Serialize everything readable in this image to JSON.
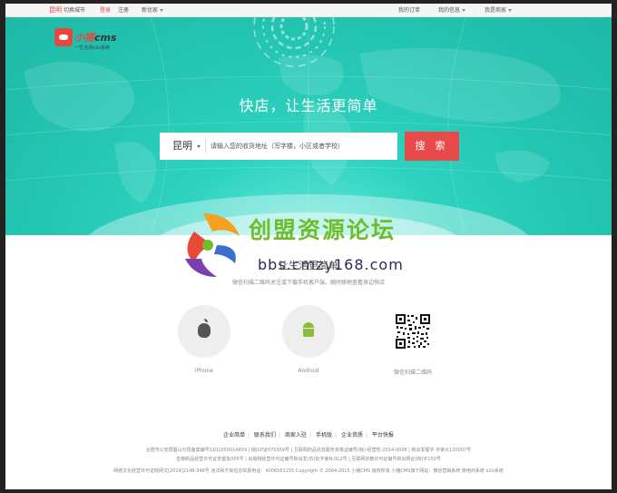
{
  "topbar": {
    "city": "昆明",
    "switch_city": "切换城市",
    "login": "登录",
    "register": "注册",
    "news": "新优家",
    "my_orders": "我的订单",
    "my_info": "我的信息",
    "merchant": "我是商家"
  },
  "logo": {
    "brand_cn": "小猪",
    "brand_en": "cms",
    "tagline": "一生活通o2o系统"
  },
  "hero": {
    "slogan": "快店，让生活更简单",
    "city_select": "昆明",
    "search_placeholder": "请输入您的收货地址（写字楼，小区或者学校）",
    "search_button": "搜 索"
  },
  "watermark": {
    "text": "创盟资源论坛",
    "url": "bbs.cmzy168.com"
  },
  "app": {
    "title": "让生活更简单",
    "subtitle": "微信扫描二维码关注或下载手机客户端，随时随地查看身边快店",
    "iphone": "iPhone",
    "android": "Android",
    "wechat": "微信扫描二维码"
  },
  "footer": {
    "links": [
      "企业简单",
      "联系我们",
      "商家入驻",
      "手机版",
      "企业资质",
      "平台快报"
    ],
    "line1": "合肥市公安局蜀山分局备案编号1101050014659 | 皖ICP证070359号 | 互联网药品信息服务资格证编号(皖)-经营性-2014-0008 | 新出发蜀字 字第大120007号",
    "line2": "音像制品经营许可证苏蜀批005号 | 出版物经营许可证编号新出发(苏)批字第N-012号 | 互联网宗教许可证编号新出网证(皖)字150号",
    "line3": "网络文化经营许可证皖网文[2014]2148-348号 违法和不良信息举报电话：4006561155 Copyright © 2004-2015 小猪CMS 版权所有 小猪CMS旗下网站：微信营销系统 微电商系统 o2o系统"
  },
  "colors": {
    "accent_red": "#e84a4a",
    "hero_teal": "#22c3b0",
    "android_green": "#8bbd3c"
  }
}
